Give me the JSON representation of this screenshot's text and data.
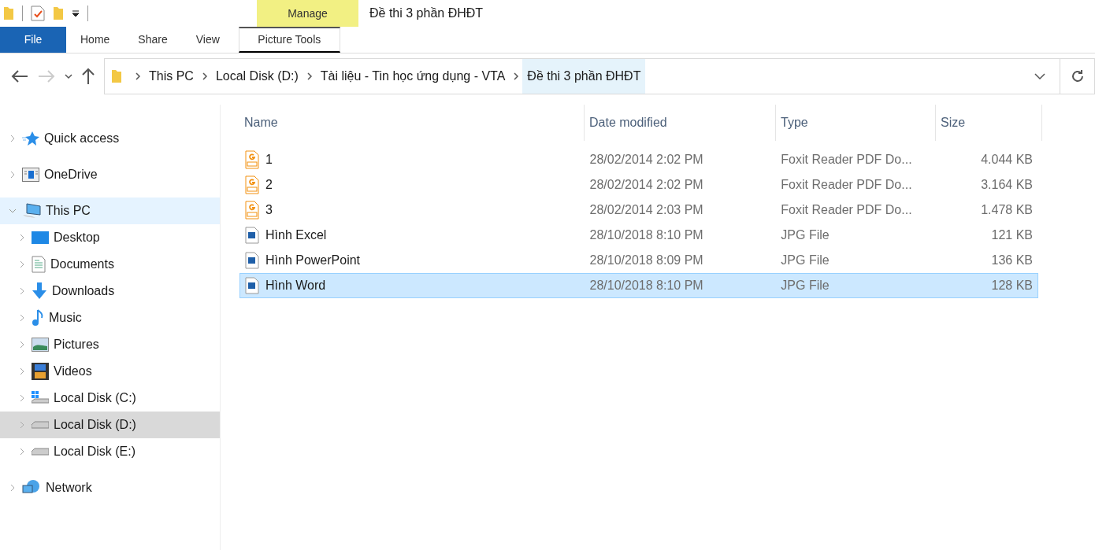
{
  "window": {
    "title": "Đề thi 3 phần ĐHĐT"
  },
  "contextual_tab": {
    "group": "Manage",
    "label": "Picture Tools"
  },
  "ribbon_tabs": [
    {
      "label": "File",
      "kind": "file",
      "selected": false
    },
    {
      "label": "Home",
      "kind": "tab",
      "selected": false
    },
    {
      "label": "Share",
      "kind": "tab",
      "selected": false
    },
    {
      "label": "View",
      "kind": "tab",
      "selected": false
    }
  ],
  "breadcrumbs": [
    {
      "label": "This PC",
      "current": false
    },
    {
      "label": "Local Disk (D:)",
      "current": false
    },
    {
      "label": "Tài liệu - Tin học ứng dụng - VTA",
      "current": false
    },
    {
      "label": "Đề thi 3 phần ĐHĐT",
      "current": true
    }
  ],
  "sidebar": {
    "items": [
      {
        "label": "Quick access",
        "expanded": false,
        "hovered": false,
        "selected": false
      },
      {
        "label": "OneDrive",
        "expanded": false,
        "hovered": false,
        "selected": false
      },
      {
        "label": "This PC",
        "expanded": true,
        "hovered": true,
        "selected": false,
        "children": [
          {
            "label": "Desktop",
            "expanded": false,
            "hovered": false,
            "selected": false
          },
          {
            "label": "Documents",
            "expanded": false,
            "hovered": false,
            "selected": false
          },
          {
            "label": "Downloads",
            "expanded": false,
            "hovered": false,
            "selected": false
          },
          {
            "label": "Music",
            "expanded": false,
            "hovered": false,
            "selected": false
          },
          {
            "label": "Pictures",
            "expanded": false,
            "hovered": false,
            "selected": false
          },
          {
            "label": "Videos",
            "expanded": false,
            "hovered": false,
            "selected": false
          },
          {
            "label": "Local Disk (C:)",
            "expanded": false,
            "hovered": false,
            "selected": false
          },
          {
            "label": "Local Disk (D:)",
            "expanded": false,
            "hovered": false,
            "selected": true
          },
          {
            "label": "Local Disk (E:)",
            "expanded": false,
            "hovered": false,
            "selected": false
          }
        ]
      },
      {
        "label": "Network",
        "expanded": false,
        "hovered": false,
        "selected": false
      }
    ]
  },
  "table": {
    "columns": [
      "Name",
      "Date modified",
      "Type",
      "Size"
    ],
    "rows": [
      {
        "kind": "pdf",
        "name": "1",
        "date": "28/02/2014 2:02 PM",
        "type": "Foxit Reader PDF Do...",
        "size": "4.044 KB",
        "selected": false
      },
      {
        "kind": "pdf",
        "name": "2",
        "date": "28/02/2014 2:02 PM",
        "type": "Foxit Reader PDF Do...",
        "size": "3.164 KB",
        "selected": false
      },
      {
        "kind": "pdf",
        "name": "3",
        "date": "28/02/2014 2:03 PM",
        "type": "Foxit Reader PDF Do...",
        "size": "1.478 KB",
        "selected": false
      },
      {
        "kind": "image",
        "name": "Hình Excel",
        "date": "28/10/2018 8:10 PM",
        "type": "JPG File",
        "size": "121 KB",
        "selected": false
      },
      {
        "kind": "image",
        "name": "Hình PowerPoint",
        "date": "28/10/2018 8:09 PM",
        "type": "JPG File",
        "size": "136 KB",
        "selected": false
      },
      {
        "kind": "image",
        "name": "Hình Word",
        "date": "28/10/2018 8:10 PM",
        "type": "JPG File",
        "size": "128 KB",
        "selected": true
      }
    ]
  }
}
